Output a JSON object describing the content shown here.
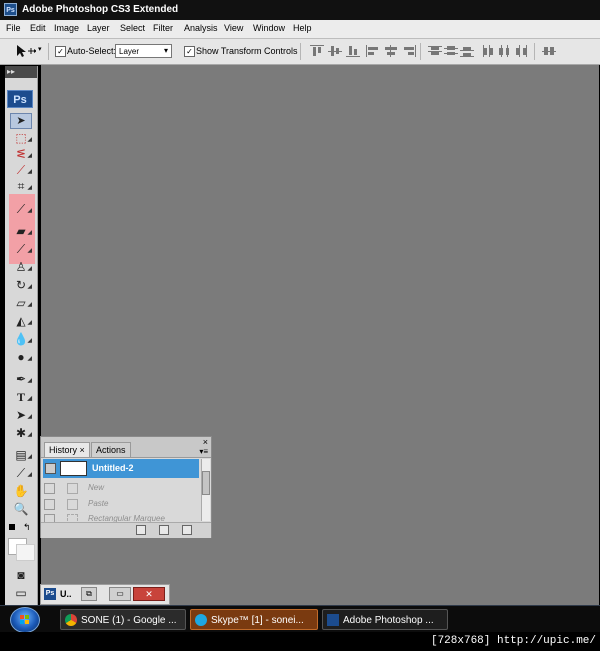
{
  "window": {
    "title": "Adobe Photoshop CS3 Extended",
    "app_icon": "Ps"
  },
  "menu": [
    "File",
    "Edit",
    "Image",
    "Layer",
    "Select",
    "Filter",
    "Analysis",
    "View",
    "Window",
    "Help"
  ],
  "options": {
    "auto_select_label": "Auto-Select:",
    "auto_select_value": "Layer",
    "show_transform_label": "Show Transform Controls",
    "auto_select_checked": "✓",
    "show_transform_checked": "✓"
  },
  "toolbox": {
    "grip": "▸▸",
    "logo": "Ps"
  },
  "history_panel": {
    "tabs": [
      "History",
      "Actions"
    ],
    "tab_close": "×",
    "panel_close": "×",
    "snapshot": "Untitled-2",
    "states": [
      "New",
      "Paste",
      "Rectangular Marquee"
    ]
  },
  "minimized_doc": {
    "label": "U.."
  },
  "taskbar": {
    "items": [
      {
        "label": "SONE (1) - Google ..."
      },
      {
        "label": "Skype™ [1] - sonei..."
      },
      {
        "label": "Adobe Photoshop ..."
      }
    ]
  },
  "watermark": "[728x768] http://upic.me/",
  "colors": {
    "workspace": "#7b7b7b",
    "history_selected": "#3f95d6",
    "tool_highlight": "#f2a0a6",
    "ps_blue": "#1c4c8e"
  }
}
